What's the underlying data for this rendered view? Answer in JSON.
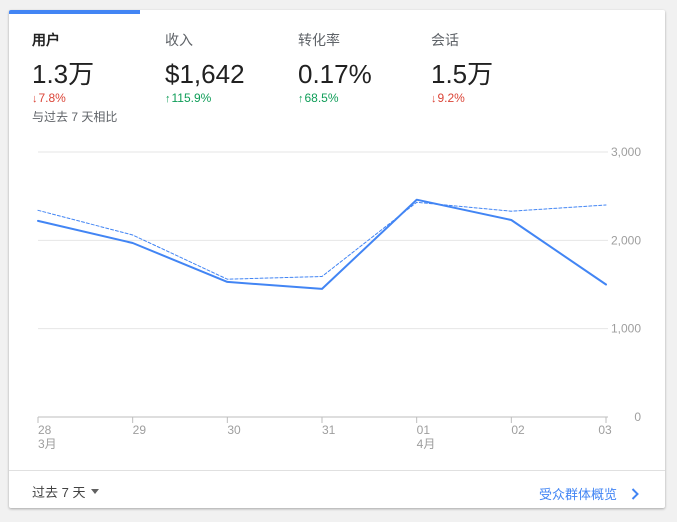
{
  "metrics": [
    {
      "label": "用户",
      "value": "1.3万",
      "change": "7.8%",
      "direction": "down"
    },
    {
      "label": "收入",
      "value": "$1,642",
      "change": "115.9%",
      "direction": "up"
    },
    {
      "label": "转化率",
      "value": "0.17%",
      "change": "68.5%",
      "direction": "up"
    },
    {
      "label": "会话",
      "value": "1.5万",
      "change": "9.2%",
      "direction": "down"
    }
  ],
  "compare_note": "与过去 7 天相比",
  "footer": {
    "range_label": "过去 7 天",
    "overview_link": "受众群体概览"
  },
  "colors": {
    "accent": "#4285f4",
    "down": "#db4437",
    "up": "#0f9d58"
  },
  "chart_data": {
    "type": "line",
    "x": [
      "28",
      "29",
      "30",
      "31",
      "01",
      "02",
      "03"
    ],
    "x_sublabels": [
      "3月",
      "",
      "",
      "",
      "4月",
      "",
      ""
    ],
    "yticks": [
      "0",
      "1,000",
      "2,000",
      "3,000"
    ],
    "ylim": [
      0,
      3000
    ],
    "series": [
      {
        "style": "solid",
        "values": [
          2220,
          1970,
          1530,
          1450,
          2460,
          2230,
          1500
        ]
      },
      {
        "style": "dashed",
        "values": [
          2340,
          2060,
          1560,
          1590,
          2430,
          2330,
          2400
        ]
      }
    ],
    "grid": true
  }
}
